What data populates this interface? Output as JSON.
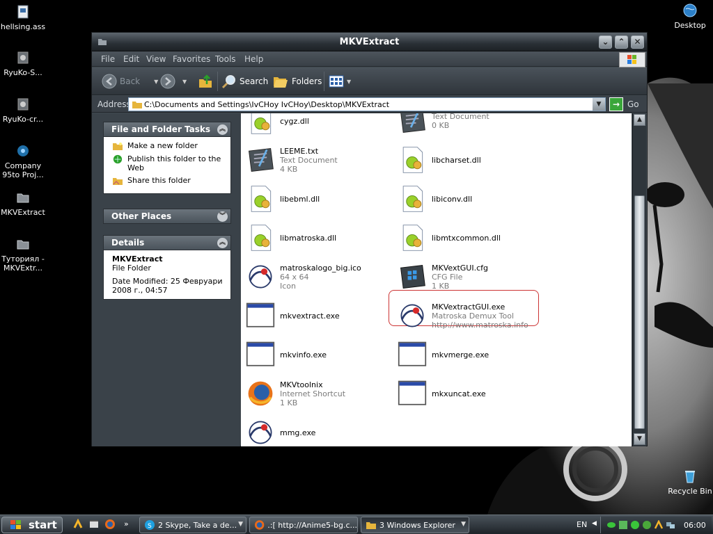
{
  "desktop": {
    "icons_left": [
      {
        "label": "hellsing.ass",
        "icon": "document-icon"
      },
      {
        "label": "RyuKo-S...",
        "icon": "mkv-file-icon"
      },
      {
        "label": "RyuKo-cr...",
        "icon": "mkv-file-icon"
      },
      {
        "label": "Company\n95to Proj...",
        "icon": "project-icon"
      },
      {
        "label": "MKVExtract",
        "icon": "folder-icon"
      },
      {
        "label": "Туториял -\nMKVExtr...",
        "icon": "folder-icon"
      }
    ],
    "icon_desktop": "Desktop",
    "icon_recycle": "Recycle Bin"
  },
  "window": {
    "title": "MKVExtract",
    "menu": [
      "File",
      "Edit",
      "View",
      "Favorites",
      "Tools",
      "Help"
    ],
    "toolbar": {
      "back": "Back",
      "search": "Search",
      "folders": "Folders"
    },
    "address": {
      "label": "Address",
      "value": "C:\\Documents and Settings\\IvCHoy IvCHoy\\Desktop\\MKVExtract",
      "go": "Go"
    },
    "tasks_panel": {
      "title": "File and Folder Tasks",
      "items": [
        "Make a new folder",
        "Publish this folder to the Web",
        "Share this folder"
      ]
    },
    "other_places": {
      "title": "Other Places"
    },
    "details": {
      "title": "Details",
      "name": "MKVExtract",
      "type": "File Folder",
      "modified": "Date Modified: 25 Февруари 2008 г., 04:57"
    },
    "files": [
      {
        "name": "cygz.dll",
        "sub1": "",
        "sub2": "",
        "icon": "dll-icon"
      },
      {
        "name": "",
        "sub1": "Text Document",
        "sub2": "0 KB",
        "icon": "text-document-icon"
      },
      {
        "name": "LEEME.txt",
        "sub1": "Text Document",
        "sub2": "4 KB",
        "icon": "text-document-icon"
      },
      {
        "name": "libcharset.dll",
        "sub1": "",
        "sub2": "",
        "icon": "dll-icon"
      },
      {
        "name": "libebml.dll",
        "sub1": "",
        "sub2": "",
        "icon": "dll-icon"
      },
      {
        "name": "libiconv.dll",
        "sub1": "",
        "sub2": "",
        "icon": "dll-icon"
      },
      {
        "name": "libmatroska.dll",
        "sub1": "",
        "sub2": "",
        "icon": "dll-icon"
      },
      {
        "name": "libmtxcommon.dll",
        "sub1": "",
        "sub2": "",
        "icon": "dll-icon"
      },
      {
        "name": "matroskalogo_big.ico",
        "sub1": "64 x 64",
        "sub2": "Icon",
        "icon": "matroska-icon"
      },
      {
        "name": "MKVextGUI.cfg",
        "sub1": "CFG File",
        "sub2": "1 KB",
        "icon": "cfg-file-icon"
      },
      {
        "name": "mkvextract.exe",
        "sub1": "",
        "sub2": "",
        "icon": "exe-window-icon"
      },
      {
        "name": "MKVextractGUI.exe",
        "sub1": "Matroska Demux Tool",
        "sub2": "http://www.matroska.info",
        "icon": "matroska-icon"
      },
      {
        "name": "mkvinfo.exe",
        "sub1": "",
        "sub2": "",
        "icon": "exe-window-icon"
      },
      {
        "name": "mkvmerge.exe",
        "sub1": "",
        "sub2": "",
        "icon": "exe-window-icon"
      },
      {
        "name": "MKVtoolnix",
        "sub1": "Internet Shortcut",
        "sub2": "1 KB",
        "icon": "firefox-icon"
      },
      {
        "name": "mkxuncat.exe",
        "sub1": "",
        "sub2": "",
        "icon": "exe-window-icon"
      },
      {
        "name": "mmg.exe",
        "sub1": "",
        "sub2": "",
        "icon": "matroska-icon"
      }
    ]
  },
  "taskbar": {
    "start": "start",
    "items": [
      {
        "label": "2 Skype, Take a de...",
        "icon": "skype-icon"
      },
      {
        "label": ".:[ http://Anime5-bg.c...",
        "icon": "firefox-icon"
      },
      {
        "label": "3 Windows Explorer",
        "icon": "folder-icon"
      }
    ],
    "lang": "EN",
    "clock": "06:00"
  },
  "colors": {
    "accent_red": "#cc3333",
    "window_dark": "#40484f",
    "selection_outline": "#cc3333"
  }
}
